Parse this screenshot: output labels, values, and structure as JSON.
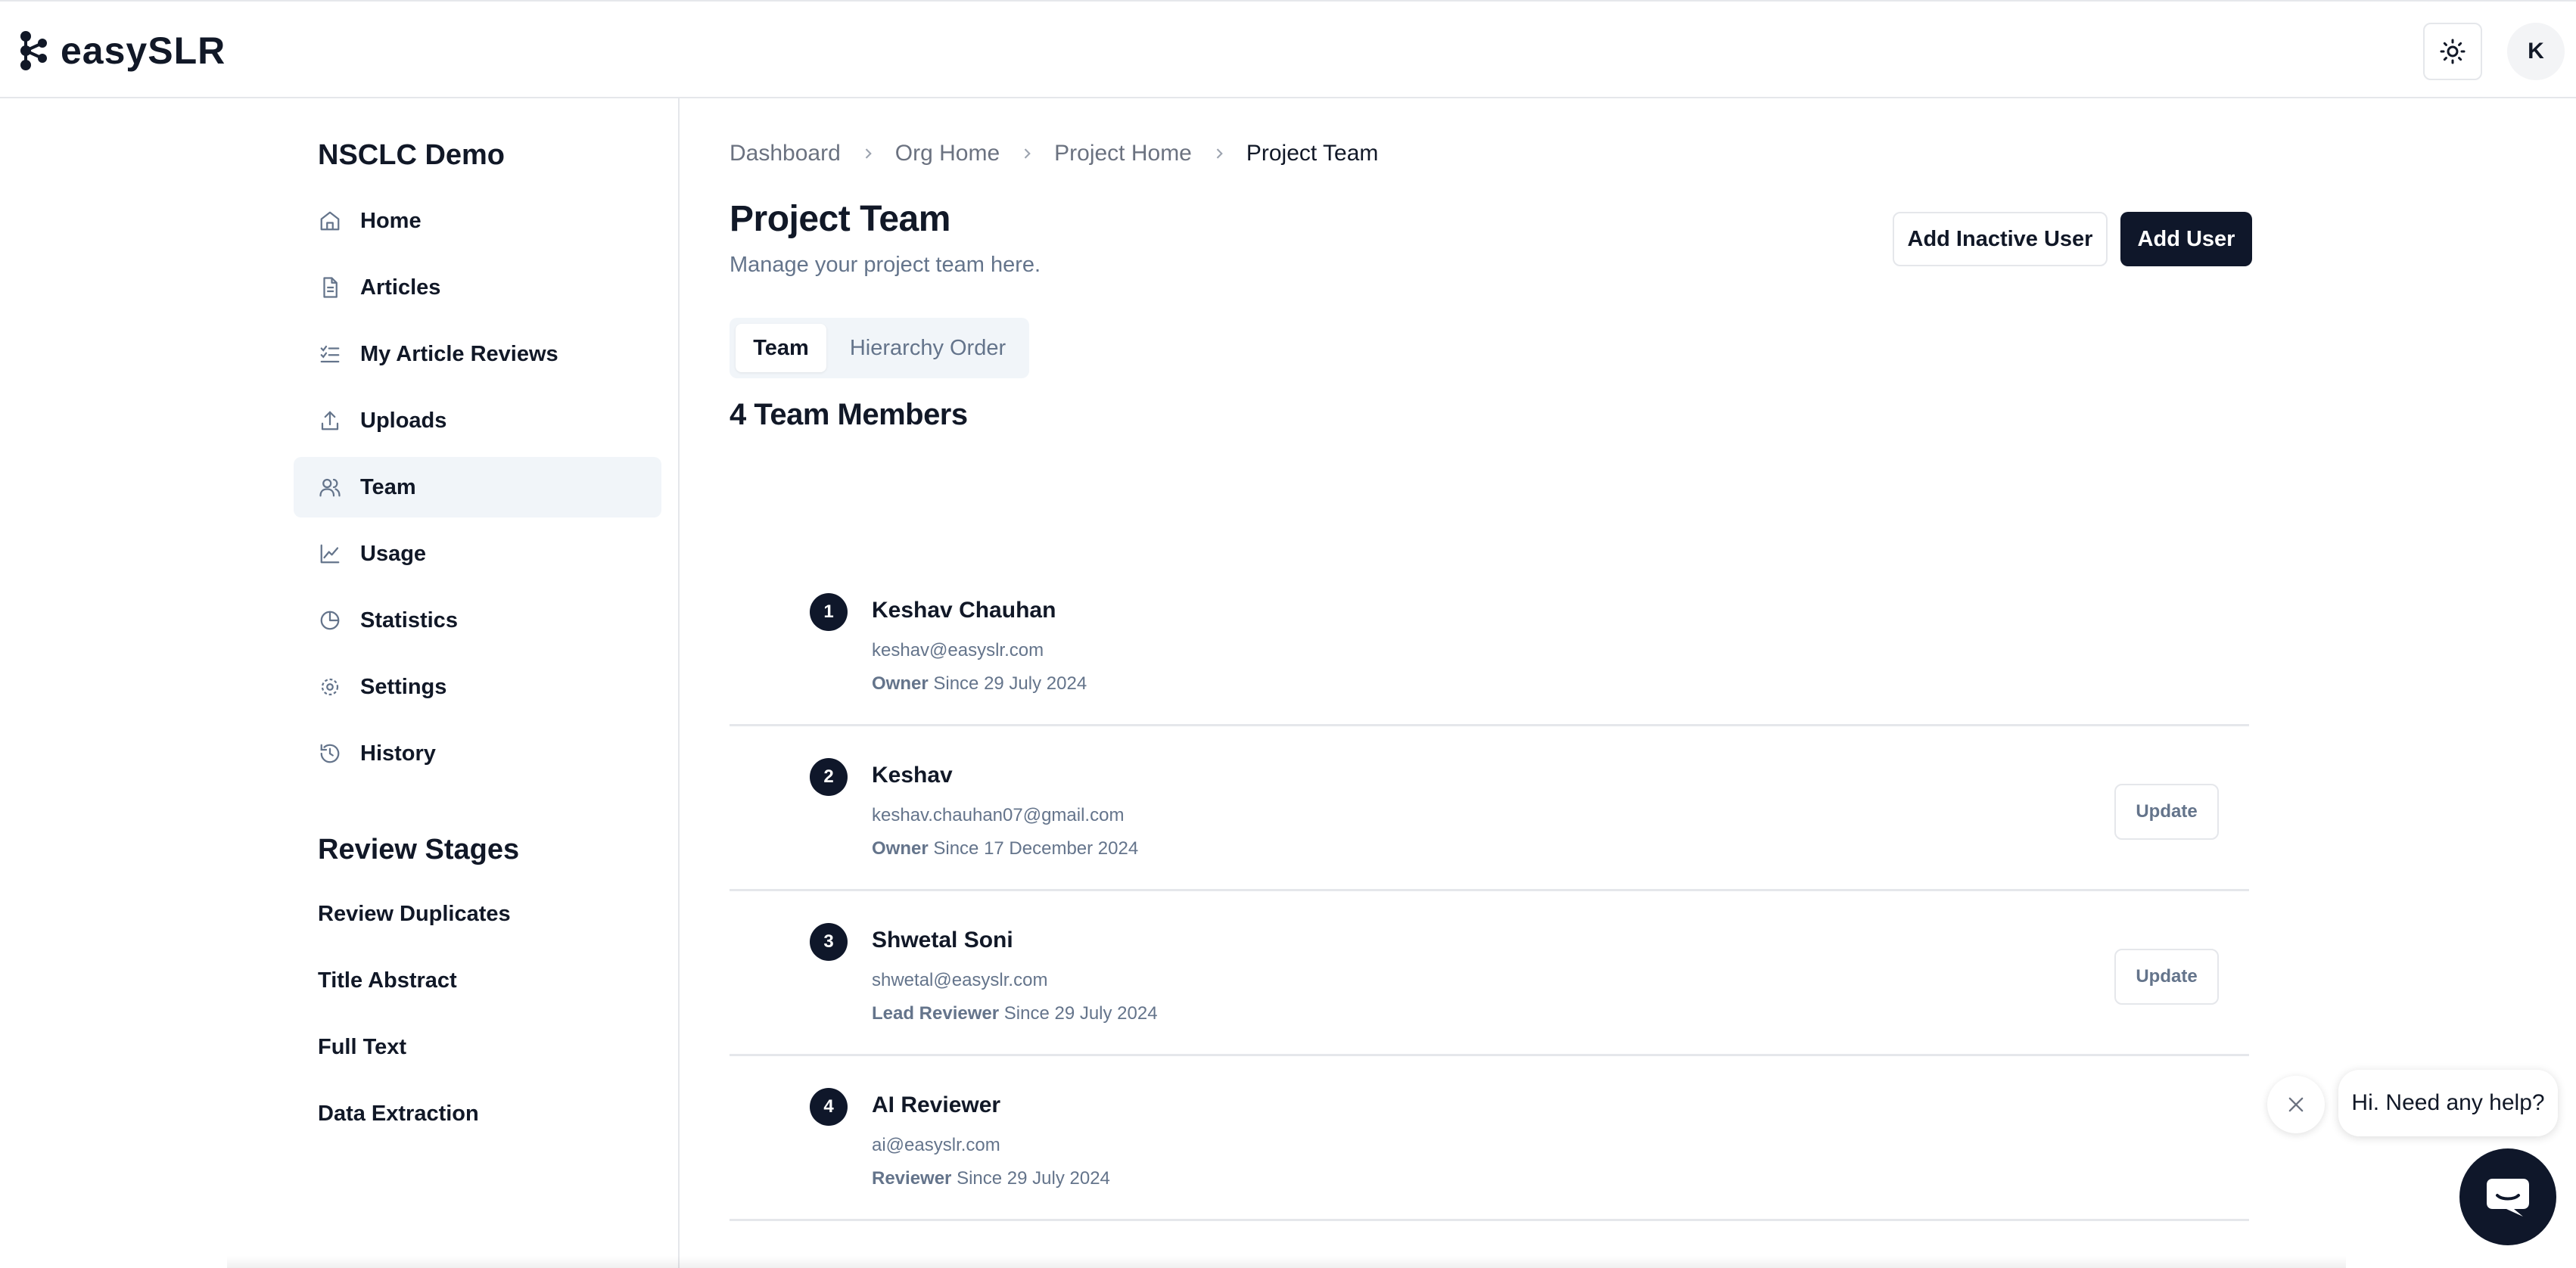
{
  "header": {
    "logo_text": "easySLR",
    "avatar_initial": "K"
  },
  "sidebar": {
    "project_name": "NSCLC Demo",
    "items": [
      {
        "label": "Home",
        "icon": "home-icon"
      },
      {
        "label": "Articles",
        "icon": "document-icon"
      },
      {
        "label": "My Article Reviews",
        "icon": "checklist-icon"
      },
      {
        "label": "Uploads",
        "icon": "upload-icon"
      },
      {
        "label": "Team",
        "icon": "users-icon",
        "active": true
      },
      {
        "label": "Usage",
        "icon": "chart-line-icon"
      },
      {
        "label": "Statistics",
        "icon": "pie-chart-icon"
      },
      {
        "label": "Settings",
        "icon": "gear-icon"
      },
      {
        "label": "History",
        "icon": "history-icon"
      }
    ],
    "stages_title": "Review Stages",
    "stages": [
      "Review Duplicates",
      "Title Abstract",
      "Full Text",
      "Data Extraction"
    ]
  },
  "breadcrumb": [
    "Dashboard",
    "Org Home",
    "Project Home",
    "Project Team"
  ],
  "main": {
    "title": "Project Team",
    "subtitle": "Manage your project team here.",
    "add_inactive_label": "Add Inactive User",
    "add_user_label": "Add User",
    "tabs": [
      "Team",
      "Hierarchy Order"
    ],
    "active_tab": "Team",
    "members_count_label": "4 Team Members"
  },
  "members": [
    {
      "num": "1",
      "name": "Keshav Chauhan",
      "email": "keshav@easyslr.com",
      "role": "Owner",
      "since": "Since 29 July 2024",
      "update_label": ""
    },
    {
      "num": "2",
      "name": "Keshav",
      "email": "keshav.chauhan07@gmail.com",
      "role": "Owner",
      "since": "Since 17 December 2024",
      "update_label": "Update"
    },
    {
      "num": "3",
      "name": "Shwetal Soni",
      "email": "shwetal@easyslr.com",
      "role": "Lead Reviewer",
      "since": "Since 29 July 2024",
      "update_label": "Update"
    },
    {
      "num": "4",
      "name": "AI Reviewer",
      "email": "ai@easyslr.com",
      "role": "Reviewer",
      "since": "Since 29 July 2024",
      "update_label": ""
    }
  ],
  "chat": {
    "prompt": "Hi. Need any help?"
  },
  "colors": {
    "primary_dark": "#0f172a",
    "muted_text": "#64748b",
    "border": "#e5e7eb",
    "active_bg": "#f1f5f9"
  }
}
